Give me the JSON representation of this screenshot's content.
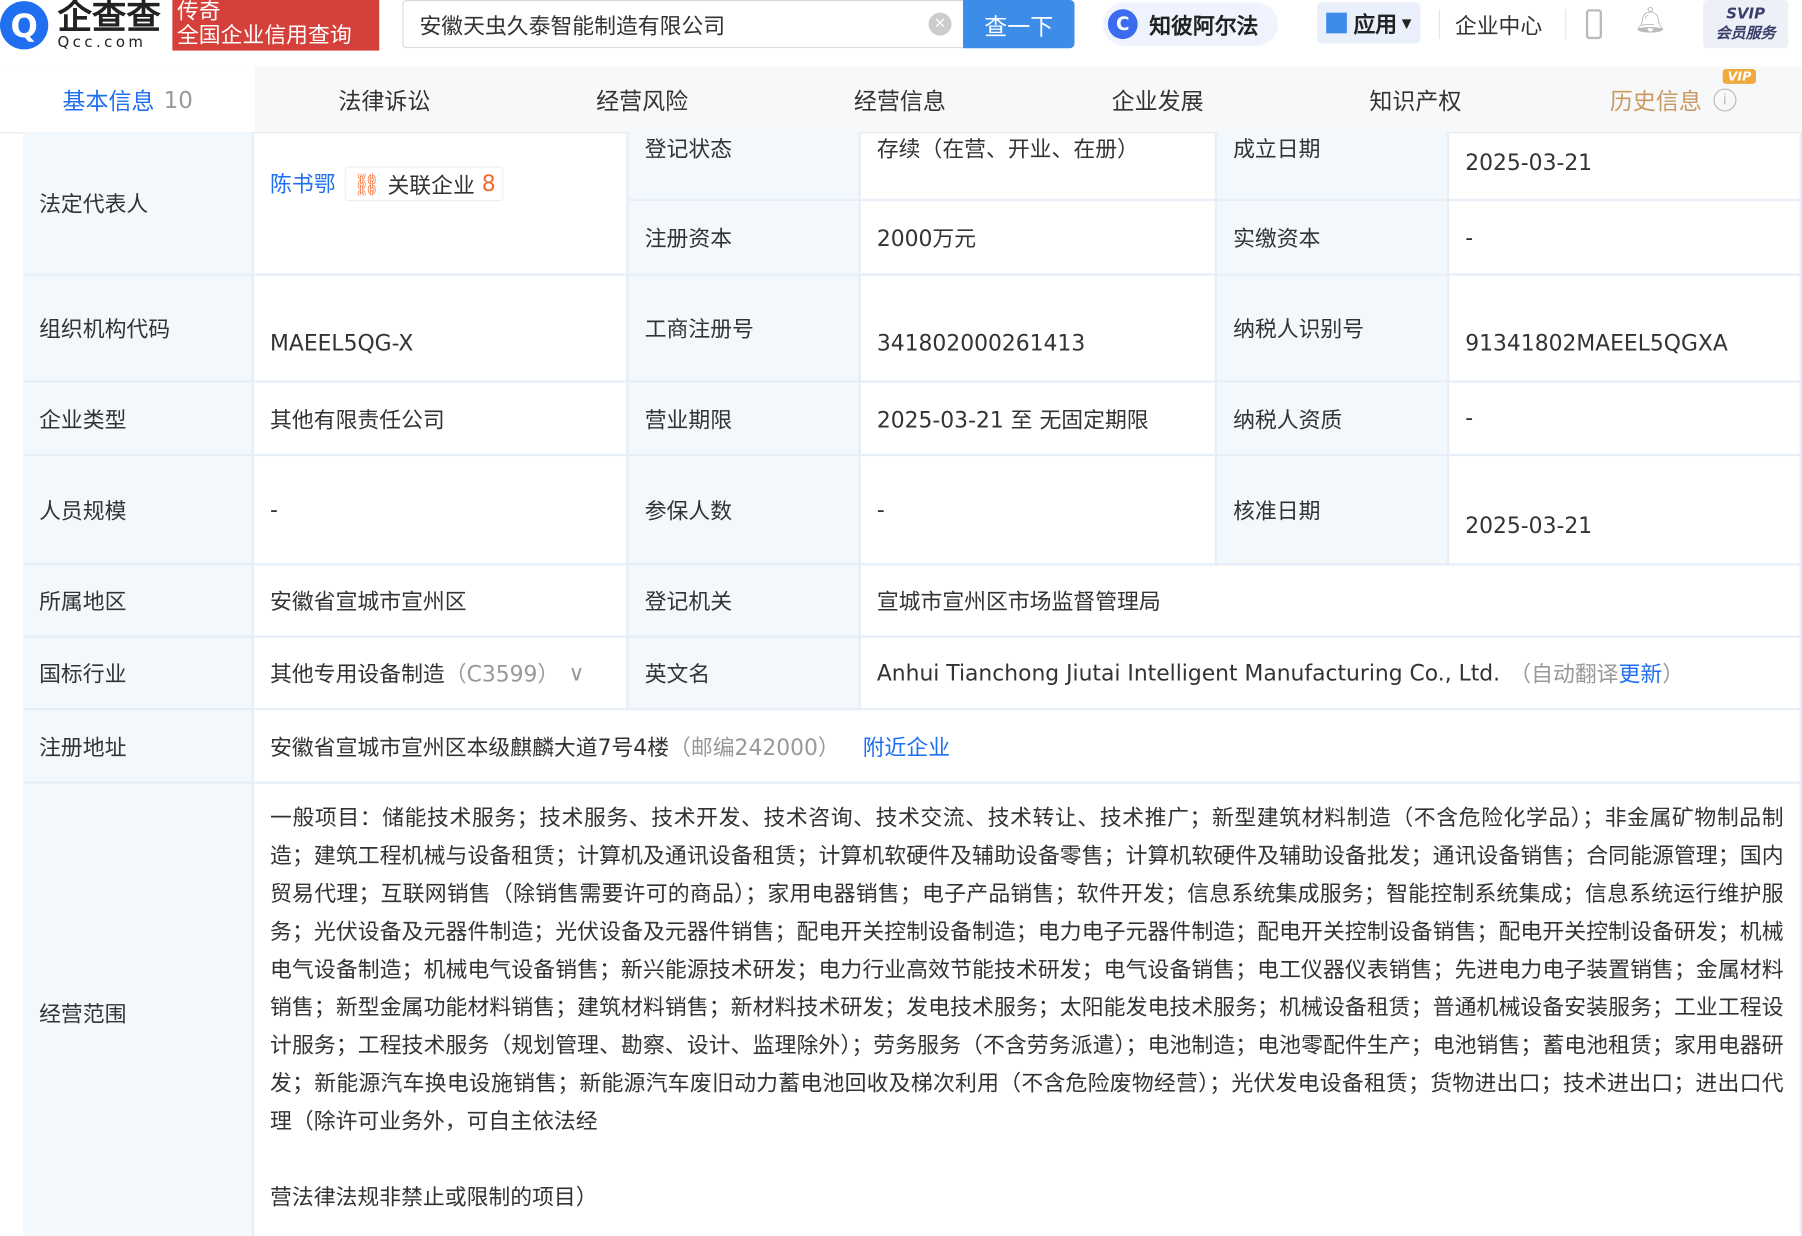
{
  "header": {
    "logo_text": "企查查",
    "logo_sub": "Qcc.com",
    "legend_line1": "传奇",
    "legend_line2": "全国企业信用查询",
    "search_value": "安徽天虫久泰智能制造有限公司",
    "search_button": "查一下",
    "ai_label": "知彼阿尔法",
    "app_label": "应用",
    "enterprise_center": "企业中心",
    "svip_line1": "SVIP",
    "svip_line2": "会员服务"
  },
  "tabs": [
    {
      "label": "基本信息",
      "count": "10"
    },
    {
      "label": "法律诉讼"
    },
    {
      "label": "经营风险"
    },
    {
      "label": "经营信息"
    },
    {
      "label": "企业发展"
    },
    {
      "label": "知识产权"
    },
    {
      "label": "历史信息",
      "badge": "VIP"
    }
  ],
  "colors": {
    "accent": "#1f6ff0",
    "label_bg": "#f3f8fd",
    "button": "#3d8ce8",
    "orange": "#f06a2f"
  },
  "info": {
    "legal_rep_label": "法定代表人",
    "legal_rep_name": "陈书鄂",
    "related_label": "关联企业",
    "related_count": "8",
    "reg_status_label": "登记状态",
    "reg_status": "存续（在营、开业、在册）",
    "found_date_label": "成立日期",
    "found_date": "2025-03-21",
    "reg_capital_label": "注册资本",
    "reg_capital": "2000万元",
    "paid_capital_label": "实缴资本",
    "paid_capital": "-",
    "org_code_label": "组织机构代码",
    "org_code": "MAEEL5QG-X",
    "biz_reg_no_label": "工商注册号",
    "biz_reg_no": "341802000261413",
    "taxpayer_id_label": "纳税人识别号",
    "taxpayer_id": "91341802MAEEL5QGXA",
    "type_label": "企业类型",
    "type": "其他有限责任公司",
    "term_label": "营业期限",
    "term": "2025-03-21 至 无固定期限",
    "tax_qual_label": "纳税人资质",
    "tax_qual": "-",
    "staff_label": "人员规模",
    "staff": "-",
    "insured_label": "参保人数",
    "insured": "-",
    "approve_label": "核准日期",
    "approve": "2025-03-21",
    "region_label": "所属地区",
    "region": "安徽省宣城市宣州区",
    "authority_label": "登记机关",
    "authority": "宣城市宣州区市场监督管理局",
    "industry_label": "国标行业",
    "industry": "其他专用设备制造",
    "industry_code": "（C3599）",
    "english_label": "英文名",
    "english": "Anhui Tianchong Jiutai Intelligent Manufacturing Co., Ltd.",
    "auto_translate": "（自动翻译",
    "update": "更新",
    "close_paren": "）",
    "address_label": "注册地址",
    "address": "安徽省宣城市宣州区本级麒麟大道7号4楼",
    "postcode": "（邮编242000）",
    "nearby": "附近企业",
    "scope_label": "经营范围",
    "scope": "一般项目：储能技术服务；技术服务、技术开发、技术咨询、技术交流、技术转让、技术推广；新型建筑材料制造（不含危险化学品）；非金属矿物制品制造；建筑工程机械与设备租赁；计算机及通讯设备租赁；计算机软硬件及辅助设备零售；计算机软硬件及辅助设备批发；通讯设备销售；合同能源管理；国内贸易代理；互联网销售（除销售需要许可的商品）；家用电器销售；电子产品销售；软件开发；信息系统集成服务；智能控制系统集成；信息系统运行维护服务；光伏设备及元器件制造；光伏设备及元器件销售；配电开关控制设备制造；电力电子元器件制造；配电开关控制设备销售；配电开关控制设备研发；机械电气设备制造；机械电气设备销售；新兴能源技术研发；电力行业高效节能技术研发；电气设备销售；电工仪器仪表销售；先进电力电子装置销售；金属材料销售；新型金属功能材料销售；建筑材料销售；新材料技术研发；发电技术服务；太阳能发电技术服务；机械设备租赁；普通机械设备安装服务；工业工程设计服务；工程技术服务（规划管理、勘察、设计、监理除外）；劳务服务（不含劳务派遣）；电池制造；电池零配件生产；电池销售；蓄电池租赁；家用电器研发；新能源汽车换电设施销售；新能源汽车废旧动力蓄电池回收及梯次利用（不含危险废物经营）；光伏发电设备租赁；货物进出口；技术进出口；进出口代理（除许可业务外，可自主依法经",
    "scope_tail": "营法律法规非禁止或限制的项目）"
  }
}
